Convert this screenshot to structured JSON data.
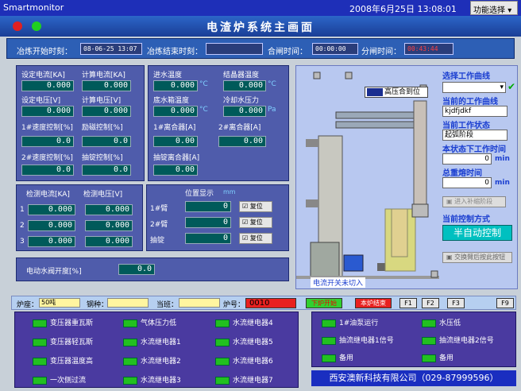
{
  "window": {
    "title": "Smartmonitor",
    "datetime": "2008年6月25日 13:08:01",
    "func_select": "功能选择"
  },
  "header": {
    "title": "电渣炉系统主画面"
  },
  "timebar": {
    "start_label": "冶炼开始时刻：",
    "start_value": "08-06-25 13:07",
    "end_label": "冶炼结束时刻：",
    "end_value": "",
    "close_label": "合闸时间：",
    "close_value": "00:00:00",
    "open_label": "分闸时间：",
    "open_value": "00:43:44"
  },
  "params": {
    "set_current_label": "设定电流[KA]",
    "set_current": "0.000",
    "calc_current_label": "计算电流[KA]",
    "calc_current": "0.000",
    "set_voltage_label": "设定电压[V]",
    "set_voltage": "0.000",
    "calc_voltage_label": "计算电压[V]",
    "calc_voltage": "0.000",
    "speed1_label": "1#速度控制[%]",
    "speed1": "0.0",
    "excite_label": "励磁控制[%]",
    "excite": "0.0",
    "speed2_label": "2#速度控制[%]",
    "speed2": "0.0",
    "extract_label": "抽锭控制[%]",
    "extract": "0.0"
  },
  "water": {
    "inlet_label": "进水温度",
    "inlet": "0.000",
    "crystal_label": "结晶器温度",
    "crystal": "0.000",
    "tank_label": "底水箱温度",
    "tank": "0.000",
    "cool_label": "冷却水压力",
    "cool": "0.000",
    "clutch1_label": "1#离合器[A]",
    "clutch1": "0.00",
    "clutch2_label": "2#离合器[A]",
    "clutch2": "0.00",
    "extract_clutch_label": "抽锭离合器[A]",
    "extract_clutch": "0.00",
    "temp_unit": "°C",
    "pressure_unit": "Pa"
  },
  "measure": {
    "current_label": "检测电流[KA]",
    "voltage_label": "检测电压[V]",
    "rows": [
      "1",
      "2",
      "3"
    ],
    "currents": [
      "0.000",
      "0.000",
      "0.000"
    ],
    "voltages": [
      "0.000",
      "0.000",
      "0.000"
    ]
  },
  "position": {
    "title": "位置显示",
    "unit": "mm",
    "arm1": "1#臂",
    "arm2": "2#臂",
    "extract": "抽锭",
    "arm1_val": "0",
    "arm2_val": "0",
    "extract_val": "0",
    "reset": "复位"
  },
  "valve": {
    "label": "电动水阀开度[%]",
    "value": "0.0"
  },
  "furnace": {
    "high_voltage": "高压合到位",
    "current_status": "电流开关未切入"
  },
  "curve": {
    "select_label": "选择工作曲线",
    "current_curve_label": "当前的工作曲线",
    "current_curve": "kjdfjdkf",
    "state_label": "当前工作状态",
    "state": "起弧阶段",
    "state_time_label": "本状态下工作时间",
    "state_time": "0",
    "min": "min",
    "total_label": "总重熔时间",
    "total": "0",
    "enter_btn": "进入补缩阶段",
    "ctrl_label": "当前控制方式",
    "ctrl_mode": "半自动控制",
    "switch_btn": "交换臂后按此按钮"
  },
  "bottom": {
    "furnace_label": "炉座：",
    "furnace_val": "50吨",
    "steel_label": "钢种：",
    "steel_val": "",
    "ingot_label": "当班：",
    "ingot_val": "",
    "no_label": "炉号：",
    "no_val": "0010",
    "btn_start": "下炉开始",
    "btn_end": "本炉结束",
    "f1": "F1",
    "f2": "F2",
    "f3": "F3",
    "f9": "F9"
  },
  "alarms_left": [
    "变压器重瓦斯",
    "气体压力低",
    "水流继电器4",
    "变压器轻瓦斯",
    "水流继电器1",
    "水流继电器5",
    "变压器温度高",
    "水流继电器2",
    "水流继电器6",
    "一次侧过流",
    "水流继电器3",
    "水流继电器7"
  ],
  "alarms_right": [
    "1#油泵运行",
    "水压低",
    "抽流继电器1信号",
    "抽流继电器2信号",
    "备用",
    "备用"
  ],
  "company": "西安澳新科技有限公司（029-87999596）"
}
